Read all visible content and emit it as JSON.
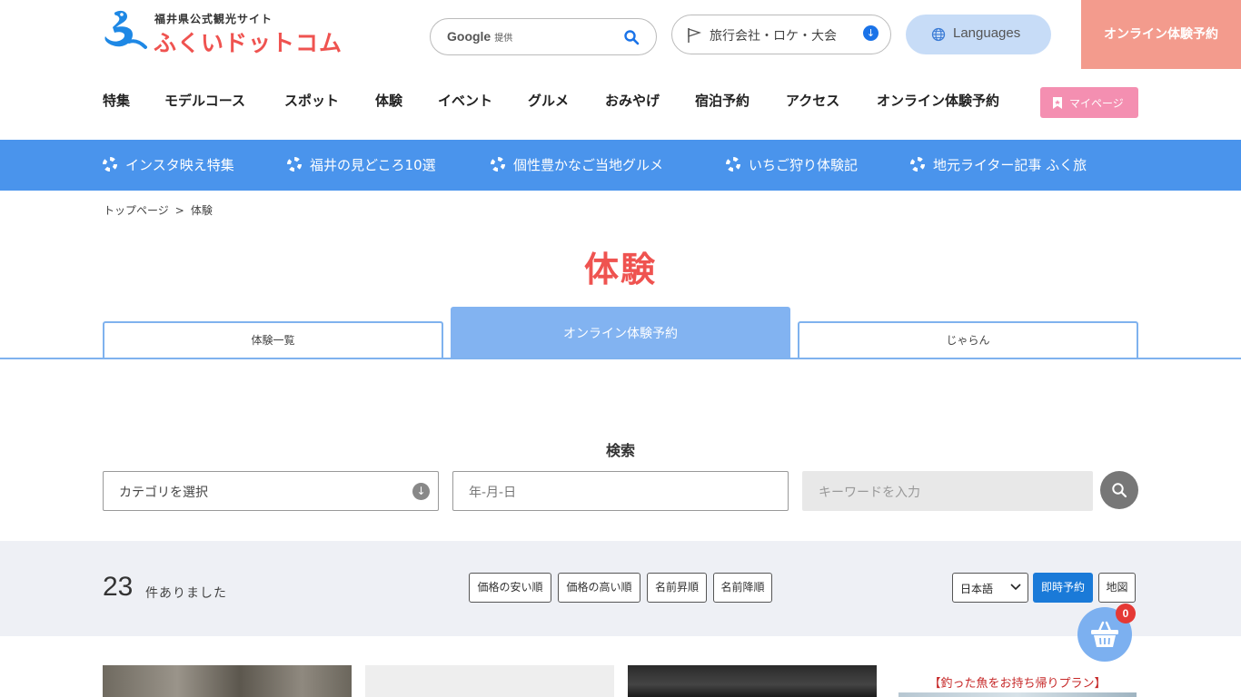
{
  "header": {
    "logo_sub": "福井県公式観光サイト",
    "logo_main": "ふくいドットコム",
    "search": {
      "provider": "Google",
      "provider_suffix": "提供",
      "icon": "search-icon"
    },
    "travel_link": "旅行会社・ロケ・大会",
    "languages": "Languages",
    "online_booking": "オンライン体験予約",
    "mypage": "マイページ"
  },
  "global_nav": [
    "特集",
    "モデルコース",
    "スポット",
    "体験",
    "イベント",
    "グルメ",
    "おみやげ",
    "宿泊予約",
    "アクセス",
    "オンライン体験予約"
  ],
  "feature_bar": [
    "インスタ映え特集",
    "福井の見どころ10選",
    "個性豊かなご当地グルメ",
    "いちご狩り体験記",
    "地元ライター記事 ふく旅"
  ],
  "breadcrumb": {
    "home": "トップページ",
    "separator": ">",
    "current": "体験"
  },
  "page_title": "体験",
  "tabs": [
    {
      "label": "体験一覧",
      "active": false
    },
    {
      "label": "オンライン体験予約",
      "active": true
    },
    {
      "label": "じゃらん",
      "active": false
    }
  ],
  "search_section": {
    "title": "検索",
    "category_placeholder": "カテゴリを選択",
    "date_placeholder": "年-月-日",
    "keyword_placeholder": "キーワードを入力"
  },
  "results": {
    "count": "23",
    "count_label": "件ありました",
    "sort_buttons": [
      "価格の安い順",
      "価格の高い順",
      "名前昇順",
      "名前降順"
    ],
    "language_selected": "日本語",
    "instant_booking": "即時予約",
    "map": "地図",
    "cart_count": "0"
  },
  "cards": {
    "promo_text": "【釣った魚をお持ち帰りプラン】"
  },
  "colors": {
    "accent_red": "#ef5350",
    "feature_blue": "#4a94ec",
    "tab_blue": "#82b3f1",
    "online_salmon": "#f39b8d",
    "mypage_pink": "#f48fb1",
    "instant_blue": "#1a7ad8"
  }
}
